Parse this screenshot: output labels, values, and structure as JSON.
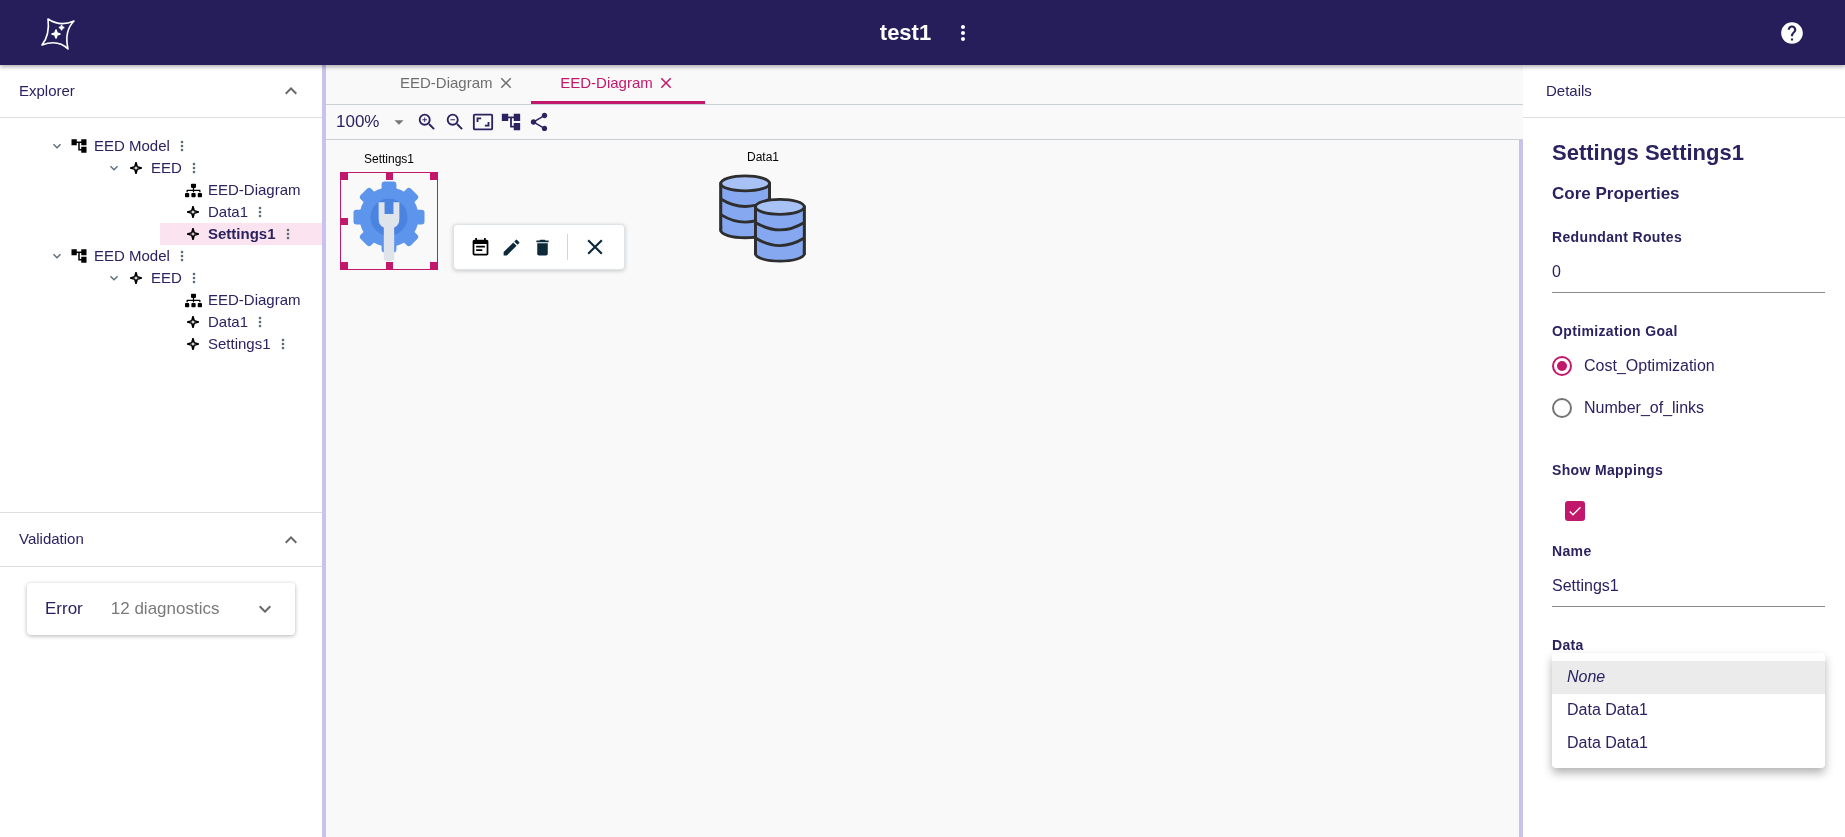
{
  "app_bar": {
    "title": "test1"
  },
  "explorer": {
    "title": "Explorer",
    "expanded": true,
    "tree": [
      {
        "label": "EED Model",
        "kind": "model",
        "expanded": true,
        "menu": true,
        "selected": false,
        "children": [
          {
            "label": "EED",
            "kind": "element",
            "expanded": true,
            "menu": true,
            "selected": false,
            "children": [
              {
                "label": "EED-Diagram",
                "kind": "diagram",
                "menu": false,
                "selected": false
              },
              {
                "label": "Data1",
                "kind": "element",
                "menu": true,
                "selected": false
              },
              {
                "label": "Settings1",
                "kind": "element",
                "menu": true,
                "selected": true
              }
            ]
          }
        ]
      },
      {
        "label": "EED Model",
        "kind": "model",
        "expanded": true,
        "menu": true,
        "selected": false,
        "children": [
          {
            "label": "EED",
            "kind": "element",
            "expanded": true,
            "menu": true,
            "selected": false,
            "children": [
              {
                "label": "EED-Diagram",
                "kind": "diagram",
                "menu": false,
                "selected": false
              },
              {
                "label": "Data1",
                "kind": "element",
                "menu": true,
                "selected": false
              },
              {
                "label": "Settings1",
                "kind": "element",
                "menu": true,
                "selected": false
              }
            ]
          }
        ]
      }
    ]
  },
  "validation": {
    "title": "Validation",
    "expanded": true,
    "severity": "Error",
    "count": "12 diagnostics"
  },
  "editor": {
    "tabs": [
      {
        "label": "EED-Diagram",
        "selected": false
      },
      {
        "label": "EED-Diagram",
        "selected": true
      }
    ],
    "zoom": "100%",
    "nodes": [
      {
        "label": "Settings1",
        "kind": "settings",
        "selected": true
      },
      {
        "label": "Data1",
        "kind": "data",
        "selected": false
      }
    ]
  },
  "details": {
    "header": "Details",
    "title": "Settings Settings1",
    "section": "Core Properties",
    "fields": [
      {
        "kind": "number",
        "label": "Redundant Routes",
        "value": "0"
      },
      {
        "kind": "radio",
        "label": "Optimization Goal",
        "options": [
          {
            "label": "Cost_Optimization",
            "selected": true
          },
          {
            "label": "Number_of_links",
            "selected": false
          }
        ]
      },
      {
        "kind": "checkbox",
        "label": "Show Mappings",
        "checked": true
      },
      {
        "kind": "text",
        "label": "Name",
        "value": "Settings1"
      },
      {
        "kind": "select",
        "label": "Data",
        "open": true,
        "options": [
          {
            "label": "None",
            "kind": "none",
            "selected": true
          },
          {
            "label": "Data Data1",
            "kind": "item",
            "selected": false
          },
          {
            "label": "Data Data1",
            "kind": "item",
            "selected": false
          }
        ]
      }
    ]
  }
}
